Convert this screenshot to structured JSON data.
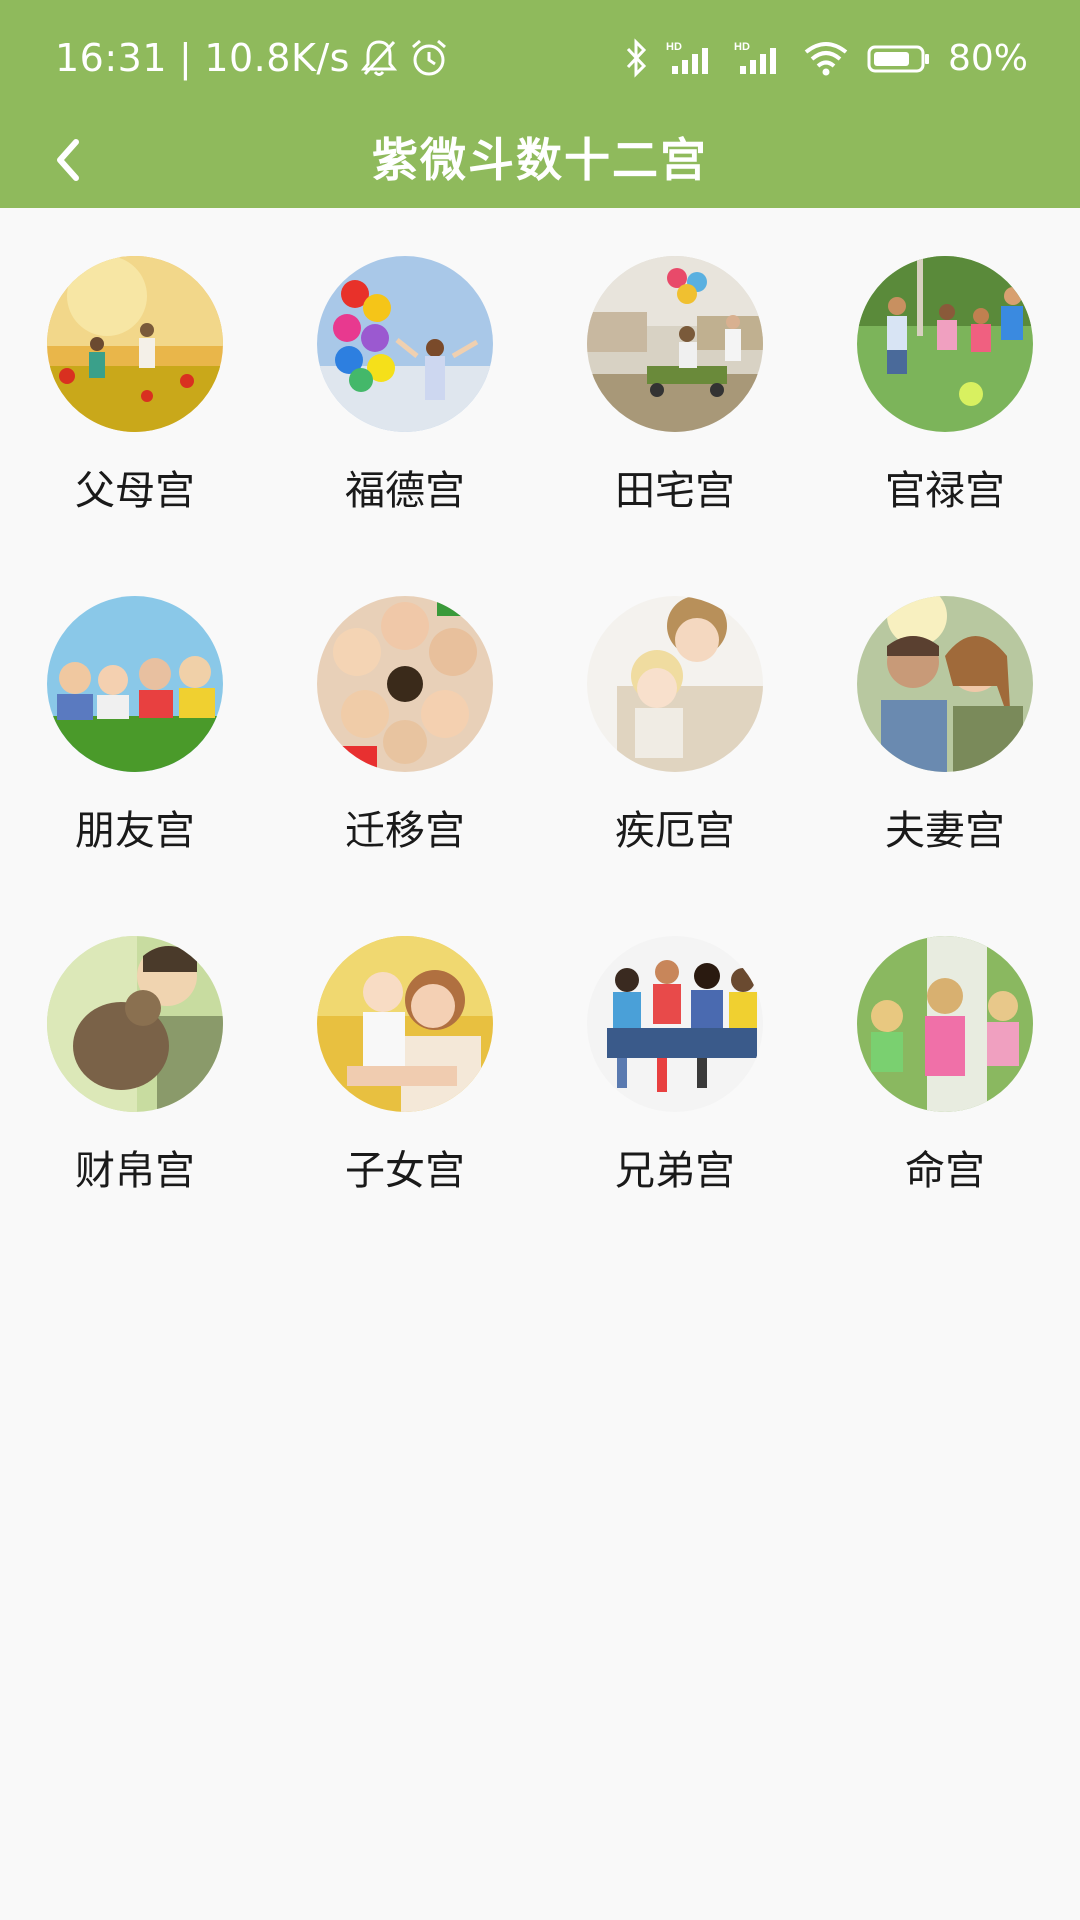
{
  "statusbar": {
    "time": "16:31",
    "network_speed": "10.8K/s",
    "battery_percent": "80%",
    "battery_level": 0.8,
    "icons": [
      "mute-bell-icon",
      "alarm-icon",
      "bluetooth-icon",
      "hd-signal-icon",
      "hd-signal-icon",
      "wifi-icon",
      "battery-icon"
    ]
  },
  "header": {
    "title": "紫微斗数十二宫",
    "back_icon": "chevron-left-icon",
    "color": "#8fba5c"
  },
  "palaces": [
    {
      "label": "父母宫",
      "image": "child-playing-in-flower-field"
    },
    {
      "label": "福德宫",
      "image": "girl-with-balloons"
    },
    {
      "label": "田宅宫",
      "image": "family-on-wagon"
    },
    {
      "label": "官禄宫",
      "image": "kids-playing-ball"
    },
    {
      "label": "朋友宫",
      "image": "children-lying-on-grass"
    },
    {
      "label": "迁移宫",
      "image": "children-circle-faces"
    },
    {
      "label": "疾厄宫",
      "image": "mother-hugging-child"
    },
    {
      "label": "夫妻宫",
      "image": "couple-kissing"
    },
    {
      "label": "财帛宫",
      "image": "boy-with-dog"
    },
    {
      "label": "子女宫",
      "image": "mother-holding-baby"
    },
    {
      "label": "兄弟宫",
      "image": "group-of-kids-sitting"
    },
    {
      "label": "命宫",
      "image": "girls-running"
    }
  ]
}
